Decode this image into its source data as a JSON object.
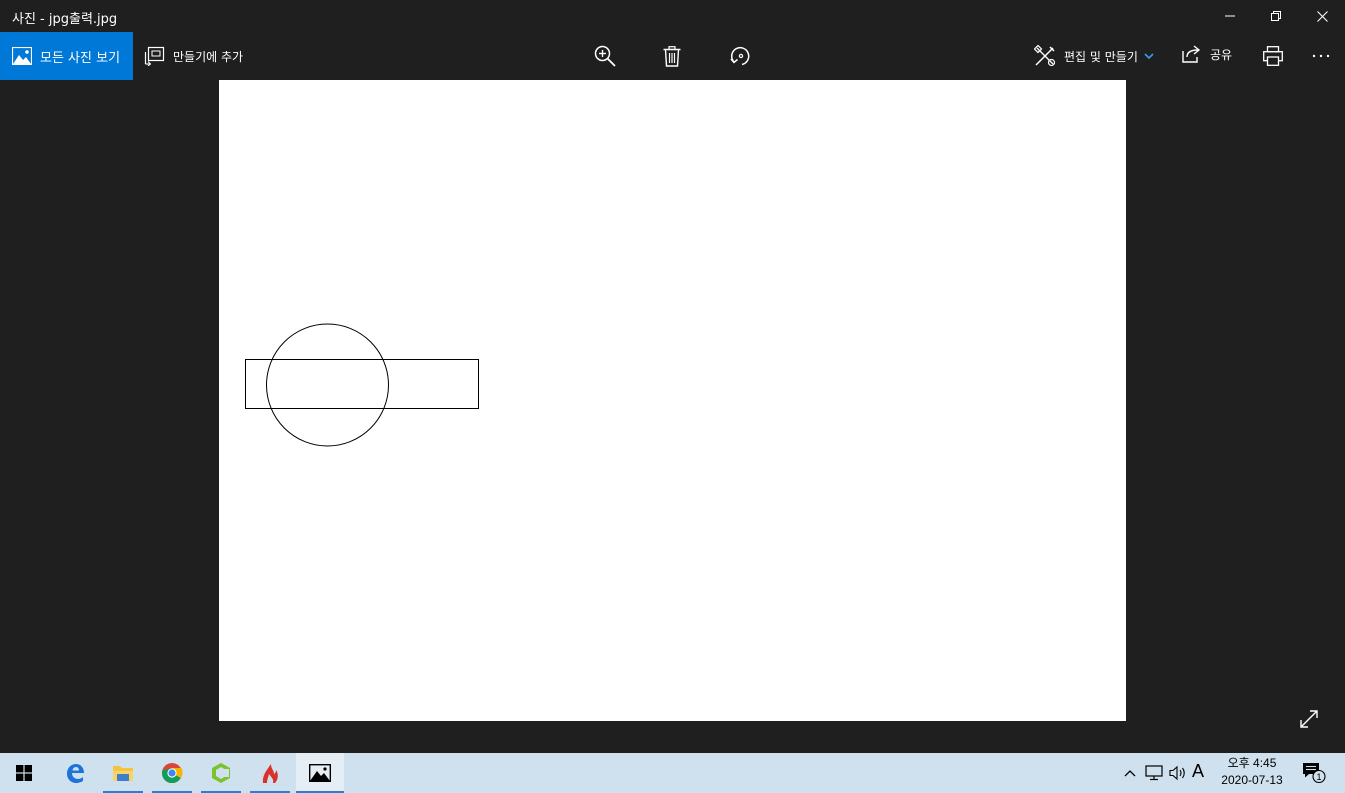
{
  "window": {
    "title": "사진 - jpg출력.jpg"
  },
  "toolbar": {
    "all_photos_label": "모든 사진 보기",
    "add_to_creation_label": "만들기에 추가",
    "edit_create_label": "편집 및 만들기",
    "share_label": "공유"
  },
  "colors": {
    "accent": "#0078d7",
    "background": "#1f1f1f",
    "taskbar": "#cfe0ee"
  },
  "icons": {
    "zoom": "zoom-in-icon",
    "delete": "trash-icon",
    "rotate": "rotate-icon",
    "print": "print-icon",
    "more": "more-icon",
    "fullscreen": "expand-icon"
  },
  "taskbar": {
    "apps": [
      "windows-start",
      "edge",
      "file-explorer",
      "chrome",
      "app-green",
      "app-red",
      "photos"
    ],
    "time": "오후 4:45",
    "date": "2020-07-13",
    "ime": "A",
    "notification_count": "1"
  }
}
